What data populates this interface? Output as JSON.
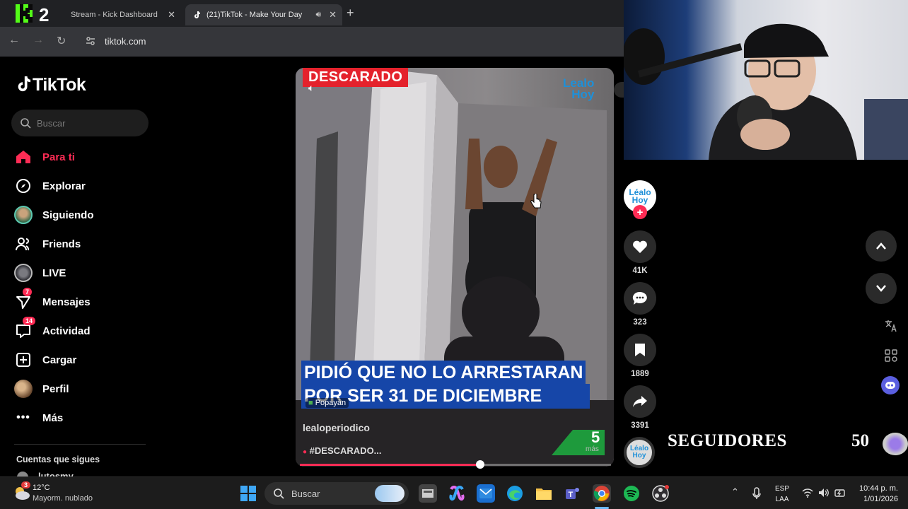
{
  "browser": {
    "tabs": [
      {
        "label": "Stream - Kick Dashboard",
        "close": "✕"
      },
      {
        "label": "(21)TikTok - Make Your Day",
        "close": "✕"
      }
    ],
    "kick_badge": "K2",
    "new_tab": "+",
    "url": "tiktok.com"
  },
  "tiktok": {
    "logo": "TikTok",
    "search_placeholder": "Buscar",
    "nav": [
      {
        "label": "Para ti",
        "icon": "home-icon",
        "active": true
      },
      {
        "label": "Explorar",
        "icon": "compass-icon"
      },
      {
        "label": "Siguiendo",
        "icon": "following-avatar"
      },
      {
        "label": "Friends",
        "icon": "friends-icon"
      },
      {
        "label": "LIVE",
        "icon": "live-avatar"
      },
      {
        "label": "Mensajes",
        "icon": "messages-icon",
        "badge": "7"
      },
      {
        "label": "Actividad",
        "icon": "activity-icon",
        "badge": "14"
      },
      {
        "label": "Cargar",
        "icon": "upload-icon"
      },
      {
        "label": "Perfil",
        "icon": "profile-avatar"
      },
      {
        "label": "Más",
        "icon": "more-icon"
      }
    ],
    "following_heading": "Cuentas que sigues",
    "following_partial": "lutosmy"
  },
  "video": {
    "tag": "DESCARADO",
    "brand_line1": "Lealo",
    "brand_line2": "Hoy",
    "caption_line1": "PIDIÓ QUE NO LO ARRESTARAN",
    "caption_line2": "POR SER 31 DE DICIEMBRE",
    "location": "Popayán",
    "author": "lealoperiodico",
    "hashtag": "#DESCARADO...",
    "more_number": "5",
    "more_label": "más",
    "progress": 0.58
  },
  "actions": {
    "creator_logo": "Léalo Hoy",
    "likes": "41K",
    "comments": "323",
    "saves": "1889",
    "shares": "3391",
    "music_logo": "Léalo Hoy"
  },
  "overlay": {
    "followers_label": "SEGUIDORES",
    "followers_count": "50"
  },
  "taskbar": {
    "weather_temp": "12°C",
    "weather_desc": "Mayorm. nublado",
    "weather_badge": "3",
    "search_label": "Buscar",
    "lang_line1": "ESP",
    "lang_line2": "LAA",
    "time": "10:44 p. m.",
    "date": "1/01/2026"
  },
  "colors": {
    "tiktok_accent": "#fe2c55",
    "caption_blue": "#1646a8",
    "tag_red": "#e4222c"
  }
}
